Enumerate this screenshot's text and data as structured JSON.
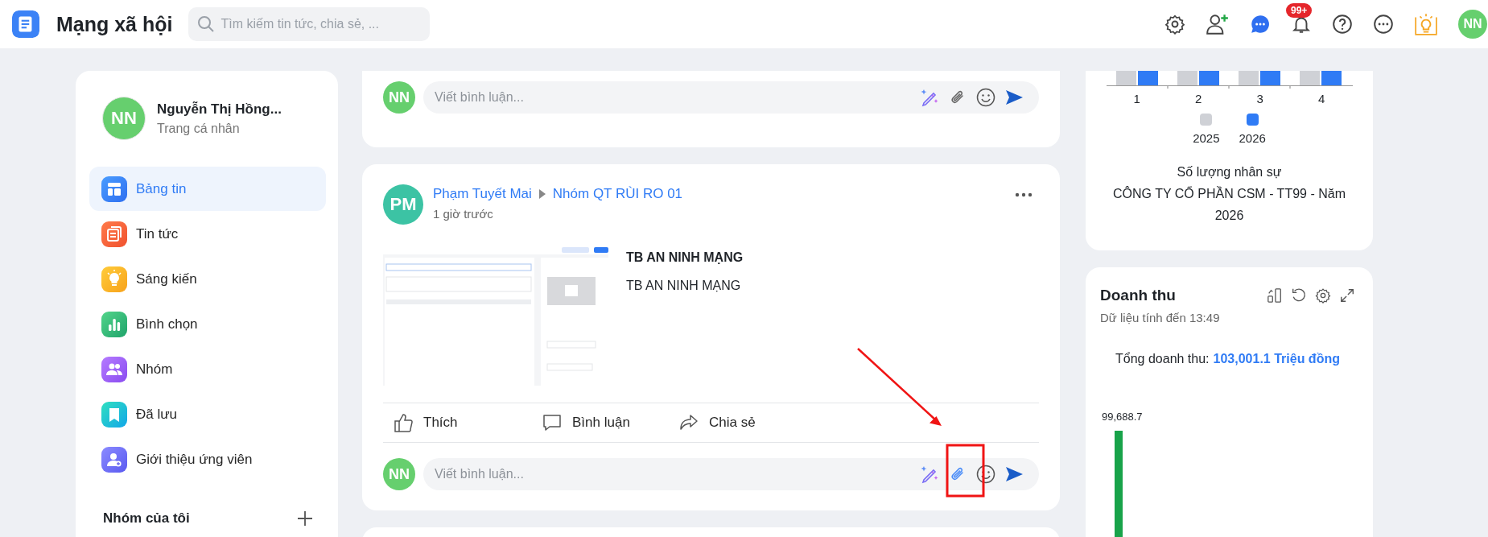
{
  "topbar": {
    "title": "Mạng xã hội",
    "search": {
      "placeholder": "Tìm kiếm tin tức, chia sẻ, ..."
    },
    "notification_badge": "99+",
    "avatar": "NN"
  },
  "sidebar": {
    "profile": {
      "avatar": "NN",
      "name": "Nguyễn Thị Hồng...",
      "link": "Trang cá nhân"
    },
    "items": [
      {
        "label": "Bảng tin",
        "selected": true
      },
      {
        "label": "Tin tức",
        "selected": false
      },
      {
        "label": "Sáng kiến",
        "selected": false
      },
      {
        "label": "Bình chọn",
        "selected": false
      },
      {
        "label": "Nhóm",
        "selected": false
      },
      {
        "label": "Đã lưu",
        "selected": false
      },
      {
        "label": "Giới thiệu ứng viên",
        "selected": false
      }
    ],
    "groups_heading": "Nhóm của tôi"
  },
  "posts": [
    {
      "kind": "comment_only",
      "comment": {
        "avatar": "NN",
        "placeholder": "Viết bình luận...",
        "attach_highlighted": false
      }
    },
    {
      "kind": "full",
      "author_avatar": "PM",
      "author": "Phạm Tuyết Mai",
      "group": "Nhóm QT RÙI RO 01",
      "time": "1 giờ trước",
      "title": "TB AN NINH MẠNG",
      "summary": "TB AN NINH MẠNG",
      "actions": [
        "Thích",
        "Bình luận",
        "Chia sẻ"
      ],
      "comment": {
        "avatar": "NN",
        "placeholder": "Viết bình luận...",
        "attach_highlighted": true
      }
    }
  ],
  "right": {
    "staff_chart": {
      "categories": [
        "1",
        "2",
        "3",
        "4"
      ],
      "legend": [
        {
          "label": "2025",
          "color": "#cfd1d6"
        },
        {
          "label": "2026",
          "color": "#2f7bf5"
        }
      ],
      "caption": [
        "Số lượng nhân sự",
        "CÔNG TY CỔ PHẦN CSM - TT99 - Năm 2026"
      ]
    },
    "revenue": {
      "title": "Doanh thu",
      "subtitle": "Dữ liệu tính đến 13:49",
      "total_label": "Tổng doanh thu:",
      "total_value": "103,001.1 Triệu đồng",
      "bar_label": "99,688.7"
    }
  }
}
